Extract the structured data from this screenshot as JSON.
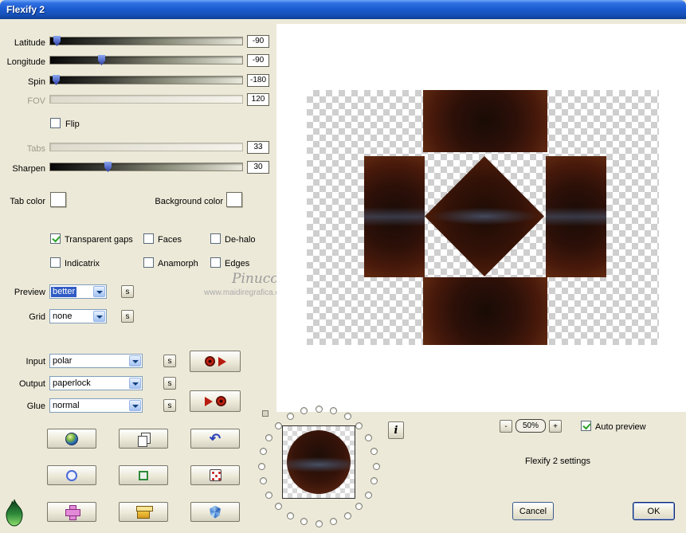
{
  "window": {
    "title": "Flexify 2"
  },
  "sliders": [
    {
      "label": "Latitude",
      "value": "-90"
    },
    {
      "label": "Longitude",
      "value": "-90"
    },
    {
      "label": "Spin",
      "value": "-180"
    },
    {
      "label": "FOV",
      "value": "120"
    },
    {
      "label": "Tabs",
      "value": "33"
    },
    {
      "label": "Sharpen",
      "value": "30"
    }
  ],
  "flip": {
    "label": "Flip"
  },
  "color_pickers": {
    "tab": "Tab color",
    "background": "Background color"
  },
  "checkboxes": {
    "transparent_gaps": "Transparent gaps",
    "faces": "Faces",
    "dehalo": "De-halo",
    "indicatrix": "Indicatrix",
    "anamorph": "Anamorph",
    "edges": "Edges"
  },
  "combos": {
    "preview": {
      "label": "Preview",
      "value": "better"
    },
    "grid": {
      "label": "Grid",
      "value": "none"
    },
    "input": {
      "label": "Input",
      "value": "polar"
    },
    "output": {
      "label": "Output",
      "value": "paperlock"
    },
    "glue": {
      "label": "Glue",
      "value": "normal"
    }
  },
  "s_button_label": "s",
  "watermark": {
    "name": "Pinuccia",
    "site": "www.maidiregrafica.eu"
  },
  "preview_panel": {
    "info_button": "i",
    "zoom_out": "-",
    "zoom_value": "50%",
    "zoom_in": "+",
    "auto_preview": "Auto preview",
    "settings_text": "Flexify 2 settings",
    "cancel": "Cancel",
    "ok": "OK"
  },
  "colors": {
    "titlebar_blue": "#1c5cd2",
    "selection_blue": "#2f5bc4",
    "check_green": "#27a227",
    "pattern_maroon": "#47190b",
    "dialog_gray": "#ece9d8"
  }
}
